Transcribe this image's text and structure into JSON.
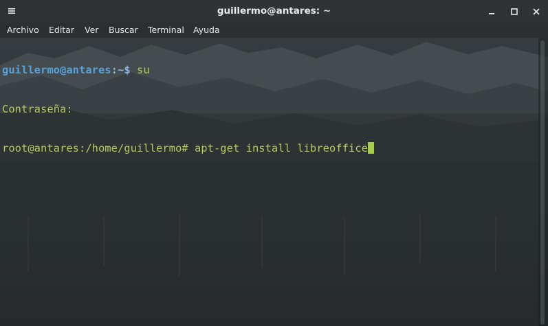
{
  "window": {
    "title": "guillermo@antares: ~",
    "menu_icon": "hamburger-icon",
    "minimize_icon": "minimize-icon",
    "maximize_icon": "maximize-icon",
    "close_icon": "close-icon"
  },
  "menubar": {
    "items": [
      {
        "label": "Archivo"
      },
      {
        "label": "Editar"
      },
      {
        "label": "Ver"
      },
      {
        "label": "Buscar"
      },
      {
        "label": "Terminal"
      },
      {
        "label": "Ayuda"
      }
    ]
  },
  "terminal": {
    "lines": [
      {
        "user": "guillermo@antares",
        "sep": ":",
        "path": "~",
        "prompt": "$ ",
        "cmd": "su"
      },
      {
        "text": "Contraseña:"
      },
      {
        "text": "root@antares:/home/guillermo# apt-get install libreoffice"
      }
    ]
  },
  "colors": {
    "prompt_user": "#58a0d8",
    "terminal_text": "#b3c95a",
    "cursor": "#a8cc48",
    "titlebar_bg": "#2f3335"
  }
}
